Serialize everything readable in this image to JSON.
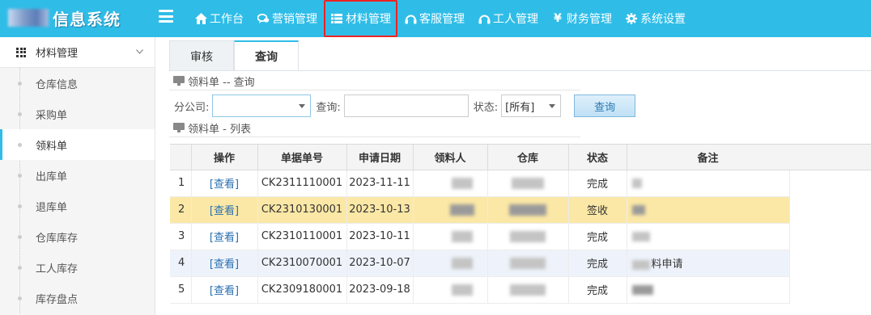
{
  "app": {
    "title": "信息系统"
  },
  "nav": [
    {
      "label": "工作台",
      "icon": "home-icon"
    },
    {
      "label": "营销管理",
      "icon": "chat-icon"
    },
    {
      "label": "材料管理",
      "icon": "list-icon",
      "highlighted": true
    },
    {
      "label": "客服管理",
      "icon": "headset-icon"
    },
    {
      "label": "工人管理",
      "icon": "headset-icon"
    },
    {
      "label": "财务管理",
      "icon": "yen-icon"
    },
    {
      "label": "系统设置",
      "icon": "gear-icon"
    }
  ],
  "sidebar": {
    "group": "材料管理",
    "items": [
      {
        "label": "仓库信息"
      },
      {
        "label": "采购单"
      },
      {
        "label": "领料单",
        "active": true
      },
      {
        "label": "出库单"
      },
      {
        "label": "退库单"
      },
      {
        "label": "仓库库存"
      },
      {
        "label": "工人库存"
      },
      {
        "label": "库存盘点"
      }
    ]
  },
  "tabs": [
    {
      "label": "审核"
    },
    {
      "label": "查询",
      "active": true
    }
  ],
  "sections": {
    "query_title": "领料单 -- 查询",
    "list_title": "领料单 - 列表"
  },
  "filter": {
    "company_label": "分公司:",
    "company_value": "",
    "query_label": "查询:",
    "query_value": "",
    "status_label": "状态:",
    "status_value": "[所有]",
    "query_button": "查询"
  },
  "table": {
    "columns": [
      "",
      "操作",
      "单据单号",
      "申请日期",
      "领料人",
      "仓库",
      "状态",
      "备注"
    ],
    "rows": [
      {
        "idx": "1",
        "action": "[查看]",
        "no": "CK2311110001",
        "date": "2023-11-11",
        "status": "完成",
        "note": ""
      },
      {
        "idx": "2",
        "action": "[查看]",
        "no": "CK2310130001",
        "date": "2023-10-13",
        "status": "签收",
        "note": ""
      },
      {
        "idx": "3",
        "action": "[查看]",
        "no": "CK2310110001",
        "date": "2023-10-11",
        "status": "完成",
        "note": ""
      },
      {
        "idx": "4",
        "action": "[查看]",
        "no": "CK2310070001",
        "date": "2023-10-07",
        "status": "完成",
        "note": "料申请"
      },
      {
        "idx": "5",
        "action": "[查看]",
        "no": "CK2309180001",
        "date": "2023-09-18",
        "status": "完成",
        "note": ""
      }
    ]
  },
  "colors": {
    "topbar": "#2fbde8",
    "highlight_row": "#fbe8a6",
    "alt_row": "#eef3fb",
    "link": "#2a6fb0",
    "annotation_box": "#e22222"
  }
}
